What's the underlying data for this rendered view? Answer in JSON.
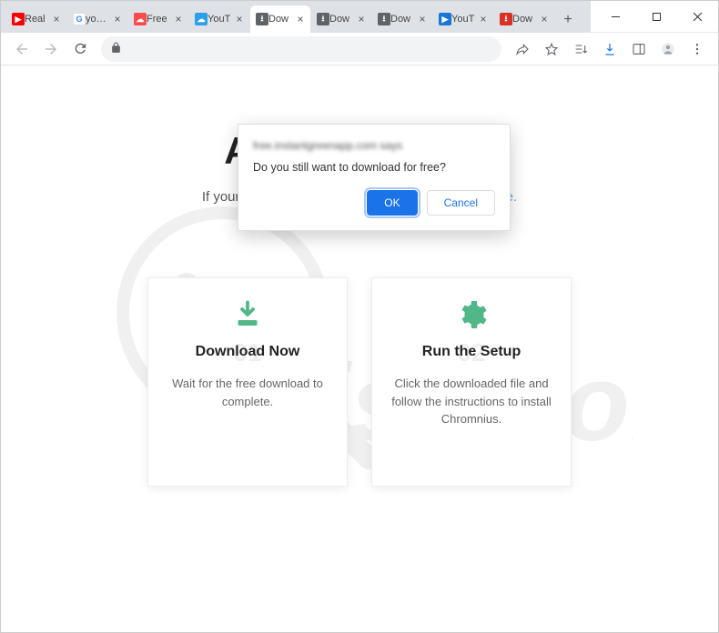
{
  "window": {
    "minimize": "—",
    "maximize": "☐",
    "close": "✕"
  },
  "tabs": [
    {
      "label": "Real",
      "iconColor": "#ff0000",
      "iconGlyph": "▶"
    },
    {
      "label": "youtu",
      "iconColor": "#fff",
      "iconGlyph": "G"
    },
    {
      "label": "Free",
      "iconColor": "#ff4a4a",
      "iconGlyph": "☁"
    },
    {
      "label": "YouT",
      "iconColor": "#2aa0e8",
      "iconGlyph": "☁"
    },
    {
      "label": "Dow",
      "iconColor": "#5f6368",
      "iconGlyph": "⭳",
      "active": true
    },
    {
      "label": "Dow",
      "iconColor": "#5f6368",
      "iconGlyph": "⭳"
    },
    {
      "label": "Dow",
      "iconColor": "#5f6368",
      "iconGlyph": "⭳"
    },
    {
      "label": "YouT",
      "iconColor": "#1976d2",
      "iconGlyph": "▶"
    },
    {
      "label": "Dow",
      "iconColor": "#d93025",
      "iconGlyph": "⭳"
    }
  ],
  "newTab": "+",
  "page": {
    "headline": "Almost There…",
    "subheadPrefix": "If your download didn't start automatically ",
    "subheadLink": "click here."
  },
  "cards": [
    {
      "num": "01",
      "title": "Download Now",
      "text": "Wait for the free download to complete."
    },
    {
      "num": "02",
      "title": "Run the Setup",
      "text": "Click the downloaded file and follow the instructions to install Chromnius."
    }
  ],
  "dialog": {
    "origin": "free.instantgreenapp.com",
    "says": " says",
    "message": "Do you still want to download for free?",
    "ok": "OK",
    "cancel": "Cancel"
  }
}
